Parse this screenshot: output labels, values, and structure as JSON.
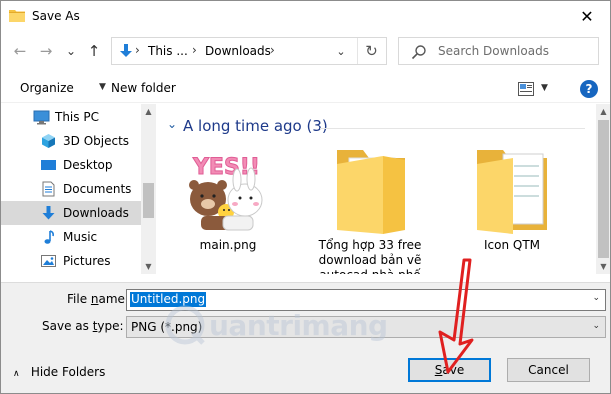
{
  "window": {
    "title": "Save As",
    "close_glyph": "✕"
  },
  "nav": {
    "back_glyph": "←",
    "forward_glyph": "→",
    "dropdown_glyph": "⌄",
    "up_glyph": "↑",
    "refresh_glyph": "↻"
  },
  "address": {
    "crumbs": [
      "This ...",
      "Downloads"
    ],
    "separator": "›"
  },
  "search": {
    "placeholder": "Search Downloads"
  },
  "toolbar": {
    "organize_label": "Organize",
    "new_folder_label": "New folder",
    "help_glyph": "?",
    "dropdown_glyph": "▼"
  },
  "sidebar": {
    "items": [
      {
        "label": "This PC",
        "icon": "computer-icon"
      },
      {
        "label": "3D Objects",
        "icon": "cube-icon"
      },
      {
        "label": "Desktop",
        "icon": "desktop-icon"
      },
      {
        "label": "Documents",
        "icon": "document-icon"
      },
      {
        "label": "Downloads",
        "icon": "download-icon",
        "selected": true
      },
      {
        "label": "Music",
        "icon": "music-icon"
      },
      {
        "label": "Pictures",
        "icon": "pictures-icon"
      }
    ]
  },
  "main": {
    "group": {
      "title": "A long time ago (3)",
      "chevron": "⌄"
    },
    "files": [
      {
        "name": "main.png",
        "type": "image"
      },
      {
        "name": "Tổng hợp 33 free download bản vẽ autocad nhà phố",
        "type": "folder"
      },
      {
        "name": "Icon QTM",
        "type": "folder"
      }
    ],
    "sticker_text": "YES!!"
  },
  "form": {
    "file_name_label": "File name:",
    "file_name_value": "Untitled.png",
    "save_type_label": "Save as type:",
    "save_type_value": "PNG (*.png)",
    "dropdown_glyph": "⌄"
  },
  "footer": {
    "hide_folders_label": "Hide Folders",
    "hide_folders_glyph": "∧",
    "save_label": "Save",
    "cancel_label": "Cancel"
  },
  "watermark": {
    "text": "uantrimang"
  },
  "colors": {
    "accent": "#0078d7",
    "annotation_arrow": "#e02020",
    "folder": "#f5c242"
  }
}
